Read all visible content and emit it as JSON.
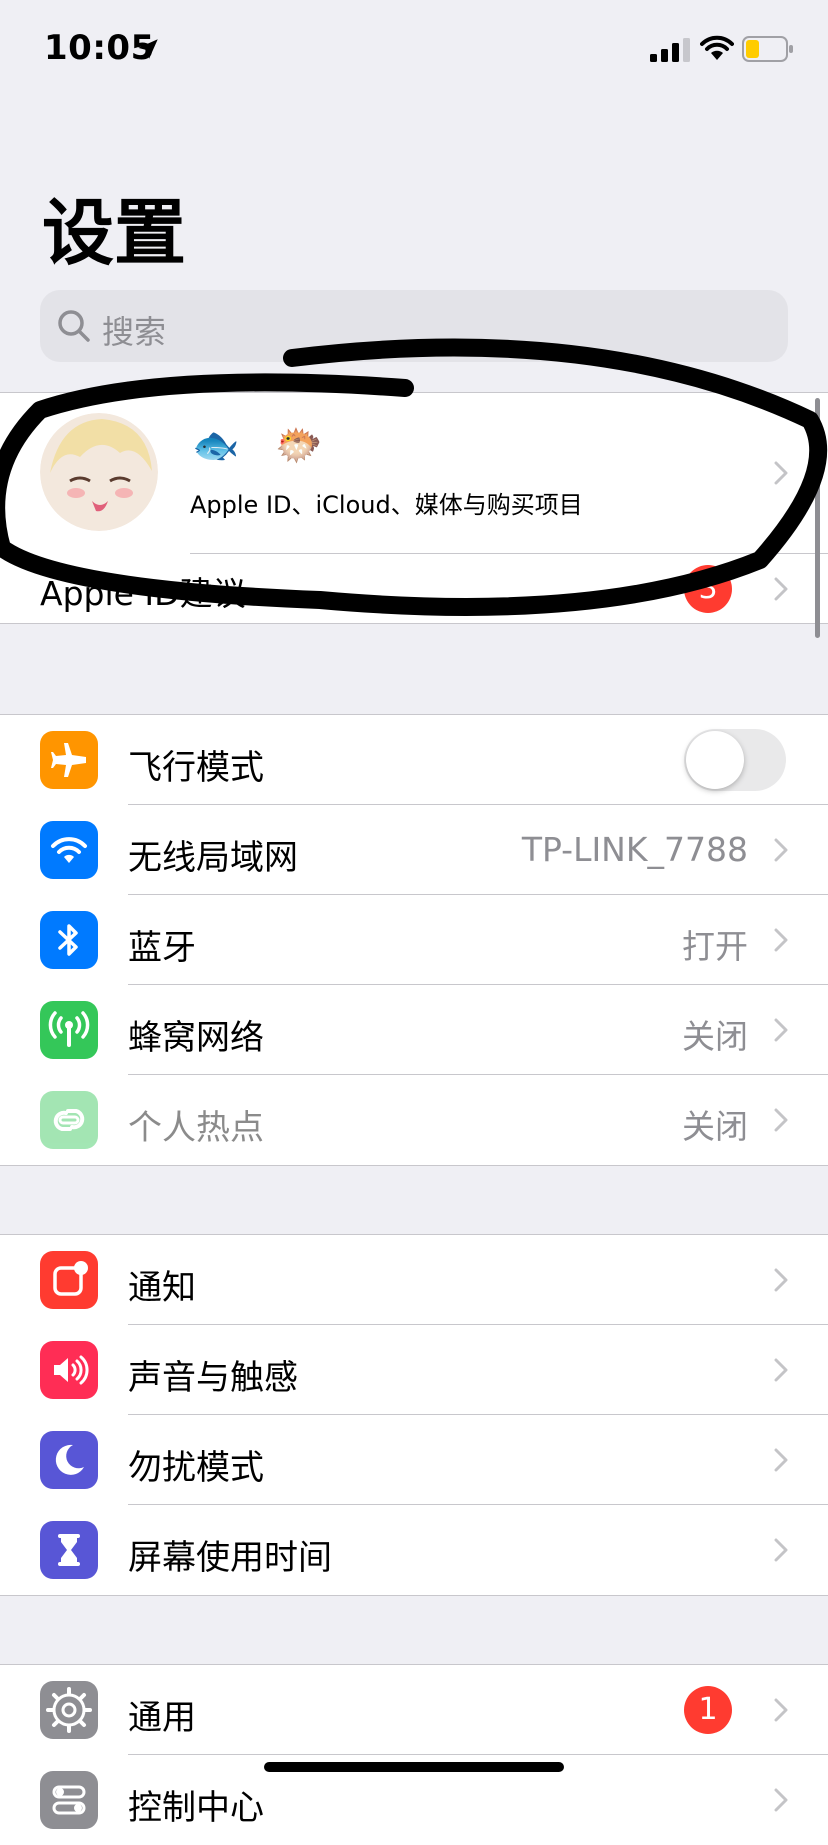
{
  "status_bar": {
    "time": "10:05",
    "battery_color": "#ffcc00"
  },
  "header": {
    "title": "设置"
  },
  "search": {
    "placeholder": "搜索"
  },
  "profile": {
    "emoji": "🐟 🐡",
    "subtitle": "Apple ID、iCloud、媒体与购买项目",
    "suggestions_label": "Apple ID建议",
    "suggestions_badge": "3"
  },
  "connectivity": [
    {
      "label": "飞行模式",
      "icon": "airplane-icon",
      "color": "#ff9500",
      "toggle": false
    },
    {
      "label": "无线局域网",
      "icon": "wifi-icon",
      "color": "#007aff",
      "value": "TP-LINK_7788"
    },
    {
      "label": "蓝牙",
      "icon": "bluetooth-icon",
      "color": "#007aff",
      "value": "打开"
    },
    {
      "label": "蜂窝网络",
      "icon": "cellular-icon",
      "color": "#34c759",
      "value": "关闭"
    },
    {
      "label": "个人热点",
      "icon": "hotspot-icon",
      "color": "#34c759",
      "value": "关闭",
      "disabled": true
    }
  ],
  "alerts": [
    {
      "label": "通知",
      "icon": "notifications-icon",
      "color": "#ff3b30"
    },
    {
      "label": "声音与触感",
      "icon": "sounds-icon",
      "color": "#ff2d55"
    },
    {
      "label": "勿扰模式",
      "icon": "moon-icon",
      "color": "#5856d6"
    },
    {
      "label": "屏幕使用时间",
      "icon": "hourglass-icon",
      "color": "#5856d6"
    }
  ],
  "system": [
    {
      "label": "通用",
      "icon": "gear-icon",
      "color": "#8e8e93",
      "badge": "1"
    },
    {
      "label": "控制中心",
      "icon": "control-center-icon",
      "color": "#8e8e93"
    }
  ]
}
